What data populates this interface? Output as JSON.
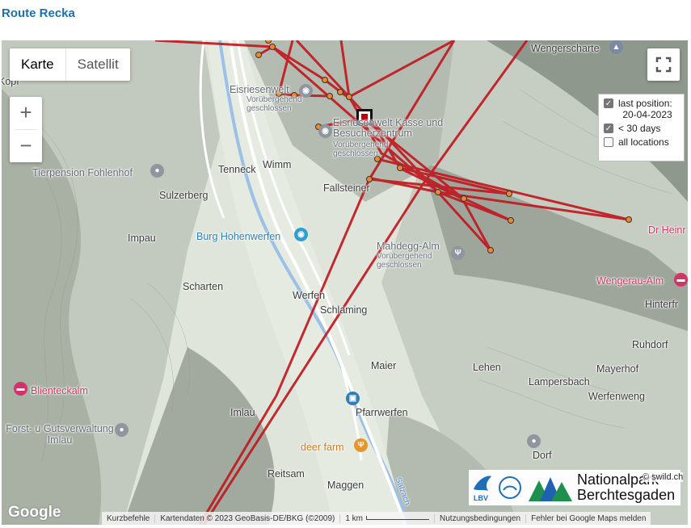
{
  "page": {
    "title": "Route Recka"
  },
  "map_controls": {
    "map_type": {
      "options": [
        "Karte",
        "Satellit"
      ],
      "selected": "Karte"
    },
    "zoom_in": "+",
    "zoom_out": "−",
    "fullscreen_icon": "fullscreen-icon"
  },
  "legend": {
    "last_position_label": "last position:",
    "last_position_date": "20-04-2023",
    "last_position_checked": true,
    "recent_label": "< 30 days",
    "recent_checked": true,
    "all_label": "all locations",
    "all_checked": false
  },
  "places": {
    "wengerscharte": "Wengerscharte",
    "kopf": "Kopf",
    "eisriesenwelt": "Eisriesenwelt",
    "eisriesenwelt_status": "Vorübergehend geschlossen",
    "eisriesenwelt_kasse": "Eisriesenwelt Kasse und Besucherzentrum",
    "eisriesenwelt_kasse_status": "Vorübergehend geschlossen",
    "tierpension": "Tierpension Fohlenhof",
    "tenneck": "Tenneck",
    "wimm": "Wimm",
    "sulzerberg": "Sulzerberg",
    "fallsteiner": "Fallsteiner",
    "impau": "Impau",
    "burg": "Burg Hohenwerfen",
    "mahdegg": "Mahdegg-Alm",
    "mahdegg_status": "Vorübergehend geschlossen",
    "dr_heinr": "Dr Heinr",
    "wengerau": "Wengerau-Alm",
    "scharten": "Scharten",
    "werfen": "Werfen",
    "schlaming": "Schlaming",
    "hinterfr": "Hinterfr",
    "ruhdorf": "Ruhdorf",
    "maier": "Maier",
    "lehen": "Lehen",
    "mayerhof": "Mayerhof",
    "lampersbach": "Lampersbach",
    "werfenweng": "Werfenweng",
    "blienteckalm": "Blienteckalm",
    "imlau": "Imlau",
    "pfarrwerfen": "Pfarrwerfen",
    "forst": "Forst- u Gutsverwaltung Imlau",
    "deer_farm": "deer farm",
    "dorf": "Dorf",
    "reitsam": "Reitsam",
    "maggen": "Maggen",
    "salzach": "Salzach"
  },
  "branding": {
    "lbv": "LBV",
    "nationalpark_line1": "Nationalpark",
    "nationalpark_line2": "Berchtesgaden",
    "google": "Google"
  },
  "footer": {
    "shortcuts": "Kurzbefehle",
    "map_data": "Kartendaten © 2023 GeoBasis-DE/BKG (©2009)",
    "scale": "1 km",
    "terms": "Nutzungsbedingungen",
    "report": "Fehler bei Google Maps melden",
    "credit": "© swild.ch"
  },
  "colors": {
    "route": "#c0161d",
    "point_fill": "#f0872e",
    "title": "#1f6fa8"
  }
}
